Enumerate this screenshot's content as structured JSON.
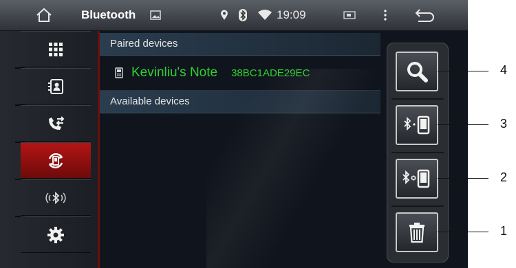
{
  "statusbar": {
    "title": "Bluetooth",
    "time": "19:09",
    "icons": [
      "home-icon",
      "image-icon",
      "location-pin-icon",
      "bluetooth-icon",
      "wifi-icon",
      "battery-icon",
      "more-vert-icon",
      "back-icon"
    ]
  },
  "sidebar": {
    "items": [
      {
        "icon": "apps-grid-icon",
        "active": false
      },
      {
        "icon": "contacts-icon",
        "active": false
      },
      {
        "icon": "call-log-icon",
        "active": false
      },
      {
        "icon": "bt-device-sync-icon",
        "active": true
      },
      {
        "icon": "bluetooth-audio-icon",
        "active": false
      },
      {
        "icon": "settings-gear-icon",
        "active": false
      }
    ],
    "accent_color": "#b31515"
  },
  "list": {
    "paired_header": "Paired devices",
    "paired_devices": [
      {
        "name": "Kevinliu's Note",
        "address": "38BC1ADE29EC"
      }
    ],
    "available_header": "Available devices",
    "device_text_color": "#2fd02f"
  },
  "actions": [
    {
      "icon": "search-icon",
      "callout": "4"
    },
    {
      "icon": "bt-connect-phone-icon",
      "callout": "3"
    },
    {
      "icon": "bt-disconnect-phone-icon",
      "callout": "2"
    },
    {
      "icon": "trash-icon",
      "callout": "1"
    }
  ]
}
